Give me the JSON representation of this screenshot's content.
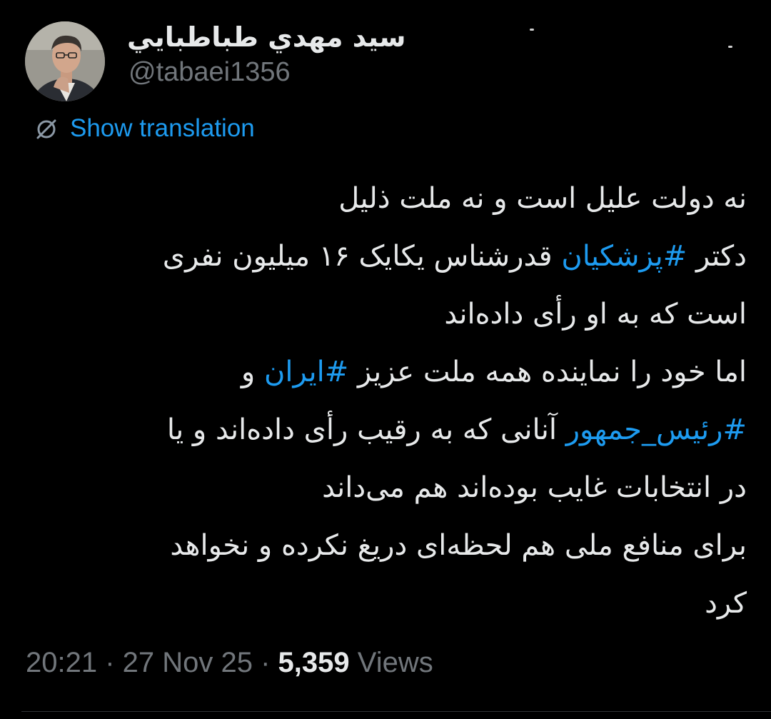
{
  "tweet": {
    "author": {
      "display_name": "سيد مهدي طباطبايي",
      "handle": "@tabaei1356",
      "avatar_icon": "profile-photo"
    },
    "translation": {
      "icon": "translate-icon",
      "label": "Show translation"
    },
    "body_lines": [
      [
        {
          "text": "نه دولت علیل است و نه ملت ذلیل"
        }
      ],
      [
        {
          "text": "دکتر "
        },
        {
          "text": "#پزشکیان",
          "hashtag": true
        },
        {
          "text": " قدرشناس یکایک ۱۶ میلیون نفری"
        }
      ],
      [
        {
          "text": "است که به او رأی داده‌اند"
        }
      ],
      [
        {
          "text": "اما خود را نماینده همه ملت عزیز "
        },
        {
          "text": "#ایران",
          "hashtag": true
        },
        {
          "text": " و"
        }
      ],
      [
        {
          "text": "#رئیس_جمهور",
          "hashtag": true
        },
        {
          "text": " آنانی که به رقیب رأی داده‌اند و یا"
        }
      ],
      [
        {
          "text": "در انتخابات غایب بوده‌اند هم می‌داند"
        }
      ],
      [
        {
          "text": "برای منافع ملی هم لحظه‌ای دریغ نکرده و نخواهد"
        }
      ],
      [
        {
          "text": "کرد"
        }
      ]
    ],
    "meta": {
      "time": "20:21",
      "separator": " · ",
      "date": "27 Nov 25",
      "views_count": "5,359",
      "views_label": " Views"
    }
  },
  "colors": {
    "background": "#000000",
    "text_primary": "#e7e9ea",
    "text_secondary": "#71767b",
    "accent_link": "#1d9bf0",
    "divider": "#2f3336"
  }
}
